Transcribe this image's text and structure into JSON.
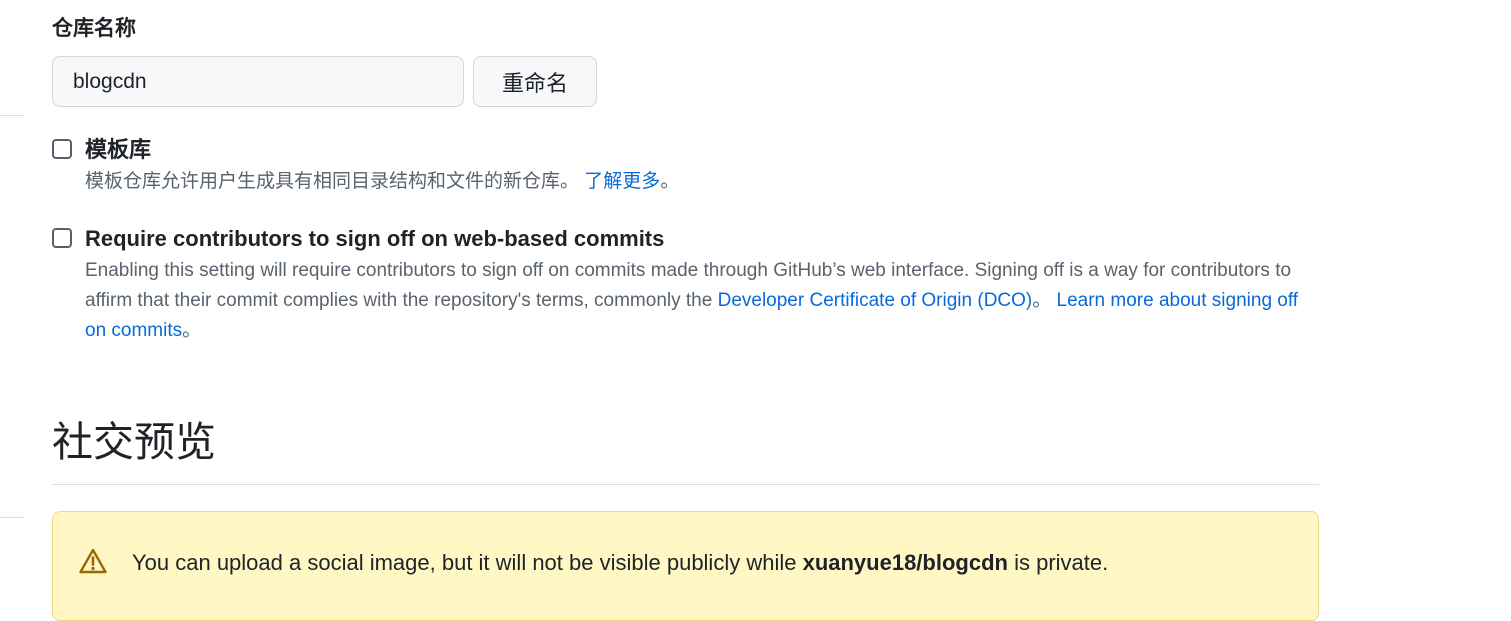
{
  "repo_name": {
    "label": "仓库名称",
    "value": "blogcdn",
    "rename_label": "重命名"
  },
  "template_repo": {
    "title": "模板库",
    "description": "模板仓库允许用户生成具有相同目录结构和文件的新仓库。",
    "learn_more": "了解更多",
    "end_punct": "。"
  },
  "sign_off": {
    "title": "Require contributors to sign off on web-based commits",
    "description_part1": "Enabling this setting will require contributors to sign off on commits made through GitHub’s web interface. Signing off is a way for contributors to affirm that their commit complies with the repository's terms, commonly the ",
    "dco_link": "Developer Certificate of Origin (DCO)",
    "description_part2": "。 ",
    "learn_more": "Learn more about signing off on commits",
    "end_punct": "。"
  },
  "social_preview": {
    "heading": "社交预览",
    "warning_prefix": "You can upload a social image, but it will not be visible publicly while ",
    "warning_repo": "xuanyue18/blogcdn",
    "warning_suffix": " is private."
  },
  "icons": {
    "warning": "alert-triangle-icon"
  },
  "colors": {
    "link": "#0969da",
    "warning_bg": "#fff8c5",
    "warning_border": "#eed888"
  }
}
